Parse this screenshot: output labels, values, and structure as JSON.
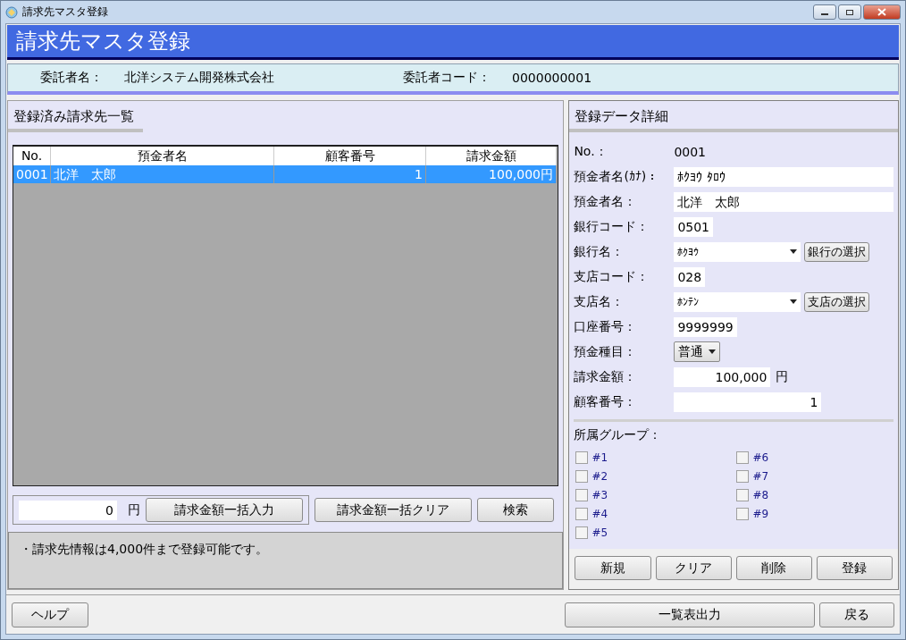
{
  "window": {
    "title": "請求先マスタ登録"
  },
  "header": {
    "title": "請求先マスタ登録"
  },
  "consignor": {
    "name_label": "委託者名：",
    "name": "北洋システム開発株式会社",
    "code_label": "委託者コード：",
    "code": "0000000001"
  },
  "list_panel": {
    "title": "登録済み請求先一覧",
    "columns": [
      "No.",
      "預金者名",
      "顧客番号",
      "請求金額"
    ],
    "rows": [
      {
        "cells": [
          "0001",
          "北洋　太郎",
          "1",
          "100,000円"
        ],
        "selected": true
      }
    ],
    "bulk_amount": "0",
    "bulk_unit": "円",
    "bulk_button": "請求金額一括入力",
    "buttons": [
      "請求金額一括クリア",
      "検索"
    ],
    "note": "・請求先情報は4,000件まで登録可能です。"
  },
  "detail_panel": {
    "title": "登録データ詳細",
    "fields": [
      {
        "kind": "static",
        "label": "No.：",
        "value": "0001"
      },
      {
        "kind": "wide",
        "label": "預金者名(ｶﾅ)：",
        "value": "ﾎｸﾖｳ ﾀﾛｳ"
      },
      {
        "kind": "wide",
        "label": "預金者名：",
        "value": "北洋　太郎"
      },
      {
        "kind": "short",
        "label": "銀行コード：",
        "value": "0501"
      },
      {
        "kind": "combo",
        "label": "銀行名：",
        "value": "ﾎｸﾖｳ",
        "button": "銀行の選択"
      },
      {
        "kind": "short",
        "label": "支店コード：",
        "value": "028"
      },
      {
        "kind": "combo",
        "label": "支店名：",
        "value": "ﾎﾝﾃﾝ",
        "button": "支店の選択"
      },
      {
        "kind": "short",
        "label": "口座番号：",
        "value": "9999999"
      },
      {
        "kind": "dropdown",
        "label": "預金種目：",
        "value": "普通"
      },
      {
        "kind": "amount",
        "label": "請求金額：",
        "value": "100,000",
        "unit": "円"
      },
      {
        "kind": "number",
        "label": "顧客番号：",
        "value": "1"
      }
    ],
    "groups_label": "所属グループ：",
    "groups": [
      {
        "label": "#1",
        "checked": false
      },
      {
        "label": "#2",
        "checked": false
      },
      {
        "label": "#3",
        "checked": false
      },
      {
        "label": "#4",
        "checked": false
      },
      {
        "label": "#5",
        "checked": false
      },
      {
        "label": "#6",
        "checked": false
      },
      {
        "label": "#7",
        "checked": false
      },
      {
        "label": "#8",
        "checked": false
      },
      {
        "label": "#9",
        "checked": false
      }
    ],
    "buttons": [
      "新規",
      "クリア",
      "削除",
      "登録"
    ]
  },
  "footer": {
    "left_buttons": [
      "ヘルプ"
    ],
    "right_buttons": [
      "一覧表出力",
      "戻る"
    ]
  }
}
